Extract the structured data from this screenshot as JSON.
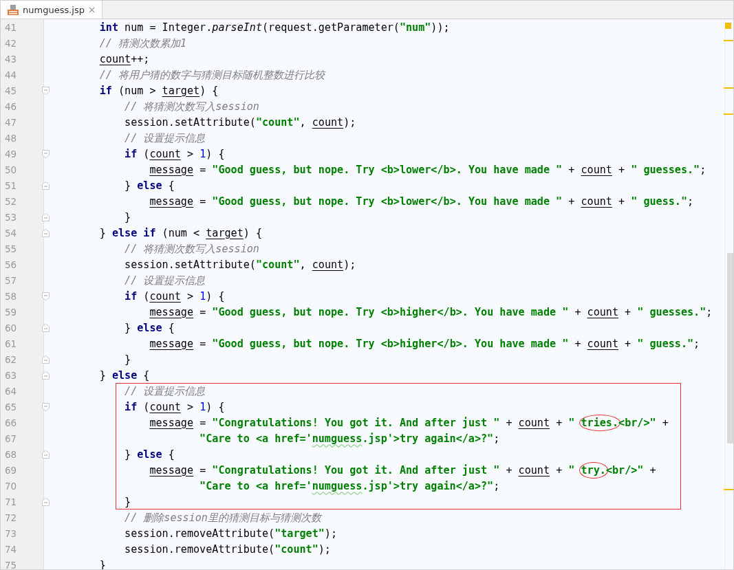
{
  "tabs": [
    {
      "label": "numguess.jsp",
      "selected": true
    }
  ],
  "editor": {
    "lines": [
      {
        "number": "41",
        "fold_start": false,
        "fold_end": false,
        "code": [
          {
            "text": "        int",
            "kind": "keyword"
          },
          {
            "text": " num = Integer.",
            "kind": "plain"
          },
          {
            "text": "parseInt",
            "kind": "method"
          },
          {
            "text": "(request.getParameter(",
            "kind": "plain"
          },
          {
            "text": "\"num\"",
            "kind": "string"
          },
          {
            "text": "));",
            "kind": "plain"
          }
        ]
      },
      {
        "number": "42",
        "fold_start": false,
        "fold_end": false,
        "code": [
          {
            "text": "        // 猜测次数累加1",
            "kind": "comment"
          }
        ]
      },
      {
        "number": "43",
        "fold_start": false,
        "fold_end": false,
        "code": [
          {
            "text": "        count",
            "kind": "field"
          },
          {
            "text": "++;",
            "kind": "plain"
          }
        ]
      },
      {
        "number": "44",
        "fold_start": false,
        "fold_end": false,
        "code": [
          {
            "text": "        // 将用户猜的数字与猜测目标随机整数进行比较",
            "kind": "comment"
          }
        ]
      },
      {
        "number": "45",
        "fold_start": true,
        "fold_end": false,
        "code": [
          {
            "text": "        if",
            "kind": "keyword"
          },
          {
            "text": " (num > ",
            "kind": "plain"
          },
          {
            "text": "target",
            "kind": "field"
          },
          {
            "text": ") {",
            "kind": "plain"
          }
        ]
      },
      {
        "number": "46",
        "fold_start": false,
        "fold_end": false,
        "code": [
          {
            "text": "            // 将猜测次数写入session",
            "kind": "comment"
          }
        ]
      },
      {
        "number": "47",
        "fold_start": false,
        "fold_end": false,
        "code": [
          {
            "text": "            session.setAttribute(",
            "kind": "plain"
          },
          {
            "text": "\"count\"",
            "kind": "string"
          },
          {
            "text": ", ",
            "kind": "plain"
          },
          {
            "text": "count",
            "kind": "field"
          },
          {
            "text": ");",
            "kind": "plain"
          }
        ]
      },
      {
        "number": "48",
        "fold_start": false,
        "fold_end": false,
        "code": [
          {
            "text": "            // 设置提示信息",
            "kind": "comment"
          }
        ]
      },
      {
        "number": "49",
        "fold_start": true,
        "fold_end": false,
        "code": [
          {
            "text": "            if",
            "kind": "keyword"
          },
          {
            "text": " (",
            "kind": "plain"
          },
          {
            "text": "count",
            "kind": "field"
          },
          {
            "text": " > ",
            "kind": "plain"
          },
          {
            "text": "1",
            "kind": "number"
          },
          {
            "text": ") {",
            "kind": "plain"
          }
        ]
      },
      {
        "number": "50",
        "fold_start": false,
        "fold_end": false,
        "code": [
          {
            "text": "                message",
            "kind": "field"
          },
          {
            "text": " = ",
            "kind": "plain"
          },
          {
            "text": "\"Good guess, but nope. Try <b>lower</b>. You have made \"",
            "kind": "string"
          },
          {
            "text": " + ",
            "kind": "plain"
          },
          {
            "text": "count",
            "kind": "field"
          },
          {
            "text": " + ",
            "kind": "plain"
          },
          {
            "text": "\" guesses.\"",
            "kind": "string"
          },
          {
            "text": ";",
            "kind": "plain"
          }
        ]
      },
      {
        "number": "51",
        "fold_start": false,
        "fold_end": true,
        "code": [
          {
            "text": "            } ",
            "kind": "plain"
          },
          {
            "text": "else",
            "kind": "keyword"
          },
          {
            "text": " {",
            "kind": "plain"
          }
        ]
      },
      {
        "number": "52",
        "fold_start": false,
        "fold_end": false,
        "code": [
          {
            "text": "                message",
            "kind": "field"
          },
          {
            "text": " = ",
            "kind": "plain"
          },
          {
            "text": "\"Good guess, but nope. Try <b>lower</b>. You have made \"",
            "kind": "string"
          },
          {
            "text": " + ",
            "kind": "plain"
          },
          {
            "text": "count",
            "kind": "field"
          },
          {
            "text": " + ",
            "kind": "plain"
          },
          {
            "text": "\" guess.\"",
            "kind": "string"
          },
          {
            "text": ";",
            "kind": "plain"
          }
        ]
      },
      {
        "number": "53",
        "fold_start": false,
        "fold_end": true,
        "code": [
          {
            "text": "            }",
            "kind": "plain"
          }
        ]
      },
      {
        "number": "54",
        "fold_start": false,
        "fold_end": true,
        "code": [
          {
            "text": "        } ",
            "kind": "plain"
          },
          {
            "text": "else if",
            "kind": "keyword"
          },
          {
            "text": " (num < ",
            "kind": "plain"
          },
          {
            "text": "target",
            "kind": "field"
          },
          {
            "text": ") {",
            "kind": "plain"
          }
        ]
      },
      {
        "number": "55",
        "fold_start": false,
        "fold_end": false,
        "code": [
          {
            "text": "            // 将猜测次数写入session",
            "kind": "comment"
          }
        ]
      },
      {
        "number": "56",
        "fold_start": false,
        "fold_end": false,
        "code": [
          {
            "text": "            session.setAttribute(",
            "kind": "plain"
          },
          {
            "text": "\"count\"",
            "kind": "string"
          },
          {
            "text": ", ",
            "kind": "plain"
          },
          {
            "text": "count",
            "kind": "field"
          },
          {
            "text": ");",
            "kind": "plain"
          }
        ]
      },
      {
        "number": "57",
        "fold_start": false,
        "fold_end": false,
        "code": [
          {
            "text": "            // 设置提示信息",
            "kind": "comment"
          }
        ]
      },
      {
        "number": "58",
        "fold_start": true,
        "fold_end": false,
        "code": [
          {
            "text": "            if",
            "kind": "keyword"
          },
          {
            "text": " (",
            "kind": "plain"
          },
          {
            "text": "count",
            "kind": "field"
          },
          {
            "text": " > ",
            "kind": "plain"
          },
          {
            "text": "1",
            "kind": "number"
          },
          {
            "text": ") {",
            "kind": "plain"
          }
        ]
      },
      {
        "number": "59",
        "fold_start": false,
        "fold_end": false,
        "code": [
          {
            "text": "                message",
            "kind": "field"
          },
          {
            "text": " = ",
            "kind": "plain"
          },
          {
            "text": "\"Good guess, but nope. Try <b>higher</b>. You have made \"",
            "kind": "string"
          },
          {
            "text": " + ",
            "kind": "plain"
          },
          {
            "text": "count",
            "kind": "field"
          },
          {
            "text": " + ",
            "kind": "plain"
          },
          {
            "text": "\" guesses.\"",
            "kind": "string"
          },
          {
            "text": ";",
            "kind": "plain"
          }
        ]
      },
      {
        "number": "60",
        "fold_start": false,
        "fold_end": true,
        "code": [
          {
            "text": "            } ",
            "kind": "plain"
          },
          {
            "text": "else",
            "kind": "keyword"
          },
          {
            "text": " {",
            "kind": "plain"
          }
        ]
      },
      {
        "number": "61",
        "fold_start": false,
        "fold_end": false,
        "code": [
          {
            "text": "                message",
            "kind": "field"
          },
          {
            "text": " = ",
            "kind": "plain"
          },
          {
            "text": "\"Good guess, but nope. Try <b>higher</b>. You have made \"",
            "kind": "string"
          },
          {
            "text": " + ",
            "kind": "plain"
          },
          {
            "text": "count",
            "kind": "field"
          },
          {
            "text": " + ",
            "kind": "plain"
          },
          {
            "text": "\" guess.\"",
            "kind": "string"
          },
          {
            "text": ";",
            "kind": "plain"
          }
        ]
      },
      {
        "number": "62",
        "fold_start": false,
        "fold_end": true,
        "code": [
          {
            "text": "            }",
            "kind": "plain"
          }
        ]
      },
      {
        "number": "63",
        "fold_start": false,
        "fold_end": true,
        "code": [
          {
            "text": "        } ",
            "kind": "plain"
          },
          {
            "text": "else",
            "kind": "keyword"
          },
          {
            "text": " {",
            "kind": "plain"
          }
        ]
      },
      {
        "number": "64",
        "boxed": true,
        "fold_start": false,
        "fold_end": false,
        "code": [
          {
            "text": "            // 设置提示信息",
            "kind": "comment"
          }
        ]
      },
      {
        "number": "65",
        "boxed": true,
        "fold_start": true,
        "fold_end": false,
        "code": [
          {
            "text": "            if",
            "kind": "keyword"
          },
          {
            "text": " (",
            "kind": "plain"
          },
          {
            "text": "count",
            "kind": "field"
          },
          {
            "text": " > ",
            "kind": "plain"
          },
          {
            "text": "1",
            "kind": "number"
          },
          {
            "text": ") {",
            "kind": "plain"
          }
        ]
      },
      {
        "number": "66",
        "boxed": true,
        "fold_start": false,
        "fold_end": false,
        "code": [
          {
            "text": "                message",
            "kind": "field"
          },
          {
            "text": " = ",
            "kind": "plain"
          },
          {
            "text": "\"Congratulations! You got it. And after just \"",
            "kind": "string"
          },
          {
            "text": " + ",
            "kind": "plain"
          },
          {
            "text": "count",
            "kind": "field"
          },
          {
            "text": " + ",
            "kind": "plain"
          },
          {
            "text": "\" ",
            "kind": "string"
          },
          {
            "text": "tries.",
            "kind": "string",
            "circled": true
          },
          {
            "text": "<br/>\"",
            "kind": "string"
          },
          {
            "text": " +",
            "kind": "plain"
          }
        ]
      },
      {
        "number": "67",
        "boxed": true,
        "fold_start": false,
        "fold_end": false,
        "code": [
          {
            "text": "                        \"Care to <a href='",
            "kind": "string"
          },
          {
            "text": "numguess",
            "kind": "typo"
          },
          {
            "text": ".jsp'>try again</a>?\"",
            "kind": "string"
          },
          {
            "text": ";",
            "kind": "plain"
          }
        ]
      },
      {
        "number": "68",
        "boxed": true,
        "fold_start": false,
        "fold_end": true,
        "code": [
          {
            "text": "            } ",
            "kind": "plain"
          },
          {
            "text": "else",
            "kind": "keyword"
          },
          {
            "text": " {",
            "kind": "plain"
          }
        ]
      },
      {
        "number": "69",
        "boxed": true,
        "fold_start": false,
        "fold_end": false,
        "code": [
          {
            "text": "                message",
            "kind": "field"
          },
          {
            "text": " = ",
            "kind": "plain"
          },
          {
            "text": "\"Congratulations! You got it. And after just \"",
            "kind": "string"
          },
          {
            "text": " + ",
            "kind": "plain"
          },
          {
            "text": "count",
            "kind": "field"
          },
          {
            "text": " + ",
            "kind": "plain"
          },
          {
            "text": "\" ",
            "kind": "string"
          },
          {
            "text": "try.",
            "kind": "string",
            "circled": true
          },
          {
            "text": "<br/>\"",
            "kind": "string"
          },
          {
            "text": " +",
            "kind": "plain"
          }
        ]
      },
      {
        "number": "70",
        "boxed": true,
        "fold_start": false,
        "fold_end": false,
        "code": [
          {
            "text": "                        \"Care to <a href='",
            "kind": "string"
          },
          {
            "text": "numguess",
            "kind": "typo"
          },
          {
            "text": ".jsp'>try again</a>?\"",
            "kind": "string"
          },
          {
            "text": ";",
            "kind": "plain"
          }
        ]
      },
      {
        "number": "71",
        "boxed": true,
        "fold_start": false,
        "fold_end": true,
        "code": [
          {
            "text": "            }",
            "kind": "plain"
          }
        ]
      },
      {
        "number": "72",
        "fold_start": false,
        "fold_end": false,
        "code": [
          {
            "text": "            // 删除session里的猜测目标与猜测次数",
            "kind": "comment"
          }
        ]
      },
      {
        "number": "73",
        "fold_start": false,
        "fold_end": false,
        "code": [
          {
            "text": "            session.removeAttribute(",
            "kind": "plain"
          },
          {
            "text": "\"target\"",
            "kind": "string"
          },
          {
            "text": ");",
            "kind": "plain"
          }
        ]
      },
      {
        "number": "74",
        "fold_start": false,
        "fold_end": false,
        "code": [
          {
            "text": "            session.removeAttribute(",
            "kind": "plain"
          },
          {
            "text": "\"count\"",
            "kind": "string"
          },
          {
            "text": ");",
            "kind": "plain"
          }
        ]
      },
      {
        "number": "75",
        "fold_start": false,
        "fold_end": false,
        "code": [
          {
            "text": "        }",
            "kind": "plain"
          }
        ]
      }
    ]
  }
}
